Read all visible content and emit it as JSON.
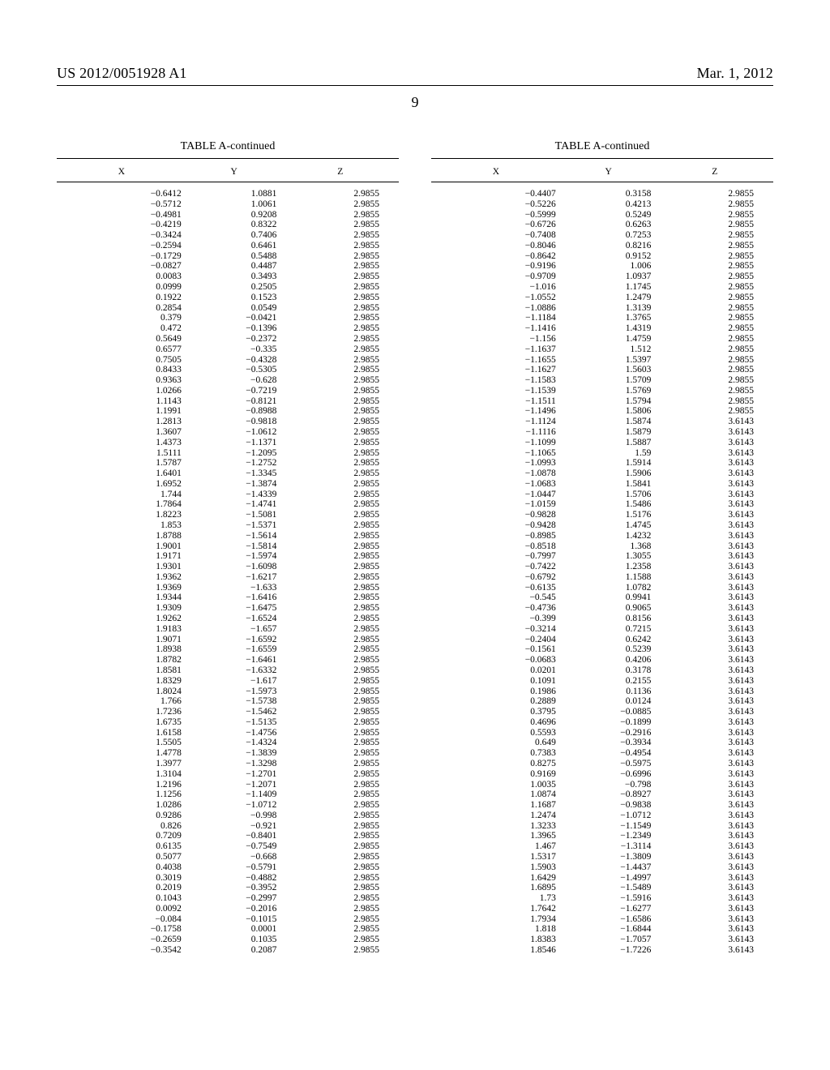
{
  "header": {
    "pub_number": "US 2012/0051928 A1",
    "pub_date": "Mar. 1, 2012"
  },
  "page_number": "9",
  "table": {
    "title": "TABLE A-continued",
    "cols": [
      "X",
      "Y",
      "Z"
    ]
  },
  "left_rows": [
    [
      "−0.6412",
      "1.0881",
      "2.9855"
    ],
    [
      "−0.5712",
      "1.0061",
      "2.9855"
    ],
    [
      "−0.4981",
      "0.9208",
      "2.9855"
    ],
    [
      "−0.4219",
      "0.8322",
      "2.9855"
    ],
    [
      "−0.3424",
      "0.7406",
      "2.9855"
    ],
    [
      "−0.2594",
      "0.6461",
      "2.9855"
    ],
    [
      "−0.1729",
      "0.5488",
      "2.9855"
    ],
    [
      "−0.0827",
      "0.4487",
      "2.9855"
    ],
    [
      "0.0083",
      "0.3493",
      "2.9855"
    ],
    [
      "0.0999",
      "0.2505",
      "2.9855"
    ],
    [
      "0.1922",
      "0.1523",
      "2.9855"
    ],
    [
      "0.2854",
      "0.0549",
      "2.9855"
    ],
    [
      "0.379",
      "−0.0421",
      "2.9855"
    ],
    [
      "0.472",
      "−0.1396",
      "2.9855"
    ],
    [
      "0.5649",
      "−0.2372",
      "2.9855"
    ],
    [
      "0.6577",
      "−0.335",
      "2.9855"
    ],
    [
      "0.7505",
      "−0.4328",
      "2.9855"
    ],
    [
      "0.8433",
      "−0.5305",
      "2.9855"
    ],
    [
      "0.9363",
      "−0.628",
      "2.9855"
    ],
    [
      "1.0266",
      "−0.7219",
      "2.9855"
    ],
    [
      "1.1143",
      "−0.8121",
      "2.9855"
    ],
    [
      "1.1991",
      "−0.8988",
      "2.9855"
    ],
    [
      "1.2813",
      "−0.9818",
      "2.9855"
    ],
    [
      "1.3607",
      "−1.0612",
      "2.9855"
    ],
    [
      "1.4373",
      "−1.1371",
      "2.9855"
    ],
    [
      "1.5111",
      "−1.2095",
      "2.9855"
    ],
    [
      "1.5787",
      "−1.2752",
      "2.9855"
    ],
    [
      "1.6401",
      "−1.3345",
      "2.9855"
    ],
    [
      "1.6952",
      "−1.3874",
      "2.9855"
    ],
    [
      "1.744",
      "−1.4339",
      "2.9855"
    ],
    [
      "1.7864",
      "−1.4741",
      "2.9855"
    ],
    [
      "1.8223",
      "−1.5081",
      "2.9855"
    ],
    [
      "1.853",
      "−1.5371",
      "2.9855"
    ],
    [
      "1.8788",
      "−1.5614",
      "2.9855"
    ],
    [
      "1.9001",
      "−1.5814",
      "2.9855"
    ],
    [
      "1.9171",
      "−1.5974",
      "2.9855"
    ],
    [
      "1.9301",
      "−1.6098",
      "2.9855"
    ],
    [
      "1.9362",
      "−1.6217",
      "2.9855"
    ],
    [
      "1.9369",
      "−1.633",
      "2.9855"
    ],
    [
      "1.9344",
      "−1.6416",
      "2.9855"
    ],
    [
      "1.9309",
      "−1.6475",
      "2.9855"
    ],
    [
      "1.9262",
      "−1.6524",
      "2.9855"
    ],
    [
      "1.9183",
      "−1.657",
      "2.9855"
    ],
    [
      "1.9071",
      "−1.6592",
      "2.9855"
    ],
    [
      "1.8938",
      "−1.6559",
      "2.9855"
    ],
    [
      "1.8782",
      "−1.6461",
      "2.9855"
    ],
    [
      "1.8581",
      "−1.6332",
      "2.9855"
    ],
    [
      "1.8329",
      "−1.617",
      "2.9855"
    ],
    [
      "1.8024",
      "−1.5973",
      "2.9855"
    ],
    [
      "1.766",
      "−1.5738",
      "2.9855"
    ],
    [
      "1.7236",
      "−1.5462",
      "2.9855"
    ],
    [
      "1.6735",
      "−1.5135",
      "2.9855"
    ],
    [
      "1.6158",
      "−1.4756",
      "2.9855"
    ],
    [
      "1.5505",
      "−1.4324",
      "2.9855"
    ],
    [
      "1.4778",
      "−1.3839",
      "2.9855"
    ],
    [
      "1.3977",
      "−1.3298",
      "2.9855"
    ],
    [
      "1.3104",
      "−1.2701",
      "2.9855"
    ],
    [
      "1.2196",
      "−1.2071",
      "2.9855"
    ],
    [
      "1.1256",
      "−1.1409",
      "2.9855"
    ],
    [
      "1.0286",
      "−1.0712",
      "2.9855"
    ],
    [
      "0.9286",
      "−0.998",
      "2.9855"
    ],
    [
      "0.826",
      "−0.921",
      "2.9855"
    ],
    [
      "0.7209",
      "−0.8401",
      "2.9855"
    ],
    [
      "0.6135",
      "−0.7549",
      "2.9855"
    ],
    [
      "0.5077",
      "−0.668",
      "2.9855"
    ],
    [
      "0.4038",
      "−0.5791",
      "2.9855"
    ],
    [
      "0.3019",
      "−0.4882",
      "2.9855"
    ],
    [
      "0.2019",
      "−0.3952",
      "2.9855"
    ],
    [
      "0.1043",
      "−0.2997",
      "2.9855"
    ],
    [
      "0.0092",
      "−0.2016",
      "2.9855"
    ],
    [
      "−0.084",
      "−0.1015",
      "2.9855"
    ],
    [
      "−0.1758",
      "0.0001",
      "2.9855"
    ],
    [
      "−0.2659",
      "0.1035",
      "2.9855"
    ],
    [
      "−0.3542",
      "0.2087",
      "2.9855"
    ]
  ],
  "right_rows": [
    [
      "−0.4407",
      "0.3158",
      "2.9855"
    ],
    [
      "−0.5226",
      "0.4213",
      "2.9855"
    ],
    [
      "−0.5999",
      "0.5249",
      "2.9855"
    ],
    [
      "−0.6726",
      "0.6263",
      "2.9855"
    ],
    [
      "−0.7408",
      "0.7253",
      "2.9855"
    ],
    [
      "−0.8046",
      "0.8216",
      "2.9855"
    ],
    [
      "−0.8642",
      "0.9152",
      "2.9855"
    ],
    [
      "−0.9196",
      "1.006",
      "2.9855"
    ],
    [
      "−0.9709",
      "1.0937",
      "2.9855"
    ],
    [
      "−1.016",
      "1.1745",
      "2.9855"
    ],
    [
      "−1.0552",
      "1.2479",
      "2.9855"
    ],
    [
      "−1.0886",
      "1.3139",
      "2.9855"
    ],
    [
      "−1.1184",
      "1.3765",
      "2.9855"
    ],
    [
      "−1.1416",
      "1.4319",
      "2.9855"
    ],
    [
      "−1.156",
      "1.4759",
      "2.9855"
    ],
    [
      "−1.1637",
      "1.512",
      "2.9855"
    ],
    [
      "−1.1655",
      "1.5397",
      "2.9855"
    ],
    [
      "−1.1627",
      "1.5603",
      "2.9855"
    ],
    [
      "−1.1583",
      "1.5709",
      "2.9855"
    ],
    [
      "−1.1539",
      "1.5769",
      "2.9855"
    ],
    [
      "−1.1511",
      "1.5794",
      "2.9855"
    ],
    [
      "−1.1496",
      "1.5806",
      "2.9855"
    ],
    [
      "−1.1124",
      "1.5874",
      "3.6143"
    ],
    [
      "−1.1116",
      "1.5879",
      "3.6143"
    ],
    [
      "−1.1099",
      "1.5887",
      "3.6143"
    ],
    [
      "−1.1065",
      "1.59",
      "3.6143"
    ],
    [
      "−1.0993",
      "1.5914",
      "3.6143"
    ],
    [
      "−1.0878",
      "1.5906",
      "3.6143"
    ],
    [
      "−1.0683",
      "1.5841",
      "3.6143"
    ],
    [
      "−1.0447",
      "1.5706",
      "3.6143"
    ],
    [
      "−1.0159",
      "1.5486",
      "3.6143"
    ],
    [
      "−0.9828",
      "1.5176",
      "3.6143"
    ],
    [
      "−0.9428",
      "1.4745",
      "3.6143"
    ],
    [
      "−0.8985",
      "1.4232",
      "3.6143"
    ],
    [
      "−0.8518",
      "1.368",
      "3.6143"
    ],
    [
      "−0.7997",
      "1.3055",
      "3.6143"
    ],
    [
      "−0.7422",
      "1.2358",
      "3.6143"
    ],
    [
      "−0.6792",
      "1.1588",
      "3.6143"
    ],
    [
      "−0.6135",
      "1.0782",
      "3.6143"
    ],
    [
      "−0.545",
      "0.9941",
      "3.6143"
    ],
    [
      "−0.4736",
      "0.9065",
      "3.6143"
    ],
    [
      "−0.399",
      "0.8156",
      "3.6143"
    ],
    [
      "−0.3214",
      "0.7215",
      "3.6143"
    ],
    [
      "−0.2404",
      "0.6242",
      "3.6143"
    ],
    [
      "−0.1561",
      "0.5239",
      "3.6143"
    ],
    [
      "−0.0683",
      "0.4206",
      "3.6143"
    ],
    [
      "0.0201",
      "0.3178",
      "3.6143"
    ],
    [
      "0.1091",
      "0.2155",
      "3.6143"
    ],
    [
      "0.1986",
      "0.1136",
      "3.6143"
    ],
    [
      "0.2889",
      "0.0124",
      "3.6143"
    ],
    [
      "0.3795",
      "−0.0885",
      "3.6143"
    ],
    [
      "0.4696",
      "−0.1899",
      "3.6143"
    ],
    [
      "0.5593",
      "−0.2916",
      "3.6143"
    ],
    [
      "0.649",
      "−0.3934",
      "3.6143"
    ],
    [
      "0.7383",
      "−0.4954",
      "3.6143"
    ],
    [
      "0.8275",
      "−0.5975",
      "3.6143"
    ],
    [
      "0.9169",
      "−0.6996",
      "3.6143"
    ],
    [
      "1.0035",
      "−0.798",
      "3.6143"
    ],
    [
      "1.0874",
      "−0.8927",
      "3.6143"
    ],
    [
      "1.1687",
      "−0.9838",
      "3.6143"
    ],
    [
      "1.2474",
      "−1.0712",
      "3.6143"
    ],
    [
      "1.3233",
      "−1.1549",
      "3.6143"
    ],
    [
      "1.3965",
      "−1.2349",
      "3.6143"
    ],
    [
      "1.467",
      "−1.3114",
      "3.6143"
    ],
    [
      "1.5317",
      "−1.3809",
      "3.6143"
    ],
    [
      "1.5903",
      "−1.4437",
      "3.6143"
    ],
    [
      "1.6429",
      "−1.4997",
      "3.6143"
    ],
    [
      "1.6895",
      "−1.5489",
      "3.6143"
    ],
    [
      "1.73",
      "−1.5916",
      "3.6143"
    ],
    [
      "1.7642",
      "−1.6277",
      "3.6143"
    ],
    [
      "1.7934",
      "−1.6586",
      "3.6143"
    ],
    [
      "1.818",
      "−1.6844",
      "3.6143"
    ],
    [
      "1.8383",
      "−1.7057",
      "3.6143"
    ],
    [
      "1.8546",
      "−1.7226",
      "3.6143"
    ]
  ]
}
